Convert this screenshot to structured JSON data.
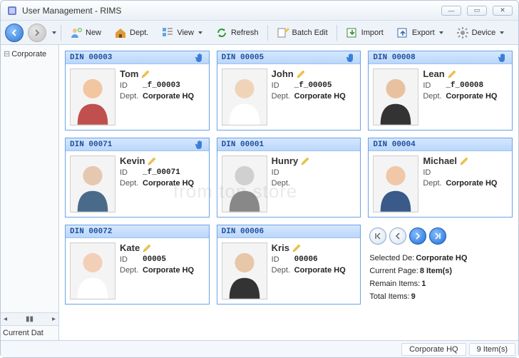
{
  "window": {
    "title": "User Management - RIMS"
  },
  "toolbar": {
    "new": "New",
    "dept": "Dept.",
    "view": "View",
    "refresh": "Refresh",
    "batch_edit": "Batch Edit",
    "import": "Import",
    "export": "Export",
    "device": "Device"
  },
  "sidebar": {
    "node": "Corporate",
    "caption": "Current Dat"
  },
  "cards": [
    {
      "din": "DIN 00003",
      "name": "Tom",
      "id": "_f_00003",
      "dept": "Corporate HQ",
      "editable": true,
      "hand": true
    },
    {
      "din": "DIN 00005",
      "name": "John",
      "id": "_f_00005",
      "dept": "Corporate HQ",
      "editable": true,
      "hand": true
    },
    {
      "din": "DIN 00008",
      "name": "Lean",
      "id": "_f_00008",
      "dept": "Corporate HQ",
      "editable": true,
      "hand": true
    },
    {
      "din": "DIN 00071",
      "name": "Kevin",
      "id": "_f_00071",
      "dept": "Corporate HQ",
      "editable": true,
      "hand": true
    },
    {
      "din": "DIN 00001",
      "name": "Hunry",
      "id": "",
      "dept": "",
      "editable": true,
      "hand": false
    },
    {
      "din": "DIN 00004",
      "name": "Michael",
      "id": "",
      "dept": "Corporate HQ",
      "editable": true,
      "hand": false
    },
    {
      "din": "DIN 00072",
      "name": "Kate",
      "id": "00005",
      "dept": "Corporate HQ",
      "editable": true,
      "hand": false
    },
    {
      "din": "DIN 00006",
      "name": "Kris",
      "id": "00006",
      "dept": "Corporate HQ",
      "editable": true,
      "hand": false
    }
  ],
  "labels": {
    "id": "ID",
    "dept": "Dept."
  },
  "pager": {
    "selected_dept_label": "Selected De:",
    "selected_dept": "Corporate HQ",
    "current_page_label": "Current Page:",
    "current_page": "8 Item(s)",
    "remain_label": "Remain Items:",
    "remain": "1",
    "total_label": "Total Items:",
    "total": "9"
  },
  "status": {
    "dept": "Corporate HQ",
    "count": "9 Item(s)"
  },
  "watermark": "from top store"
}
